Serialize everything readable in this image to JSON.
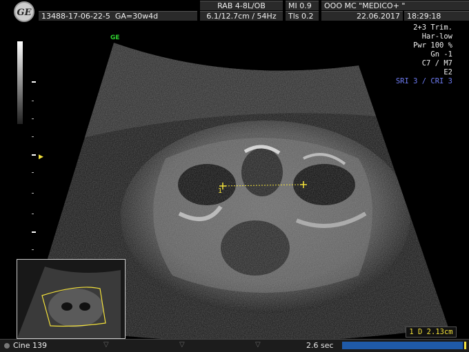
{
  "header": {
    "logo": "GE",
    "patient_id": "13488-17-06-22-5",
    "ga": "GA=30w4d",
    "probe": "RAB 4-8L/OB",
    "depth_freq": "6.1/12.7cm / 54Hz",
    "mi": "MI  0.9",
    "tis": "Tls  0.2",
    "org": "OOO  MC \"MEDICO+ \"",
    "date": "22.06.2017",
    "time": "18:29:18"
  },
  "params": {
    "preset": "2+3 Trim.",
    "harmonic": "Har-low",
    "power": "Pwr 100 %",
    "gain": "Gn  -1",
    "map": "C7 / M7",
    "enhance": "E2",
    "sri": "SRI 3 / CRI 3"
  },
  "ge_mark": "GE",
  "caliper": {
    "label": "1"
  },
  "measurement": {
    "text": "1  D 2.13cm"
  },
  "footer": {
    "cine": "Cine 139",
    "duration": "2.6 sec",
    "cine_progress": 0.97
  },
  "colors": {
    "caliper": "#f4e23b",
    "sri": "#6f7df5",
    "ge_green": "#2fd02f",
    "bar": "#1f5aa8"
  }
}
